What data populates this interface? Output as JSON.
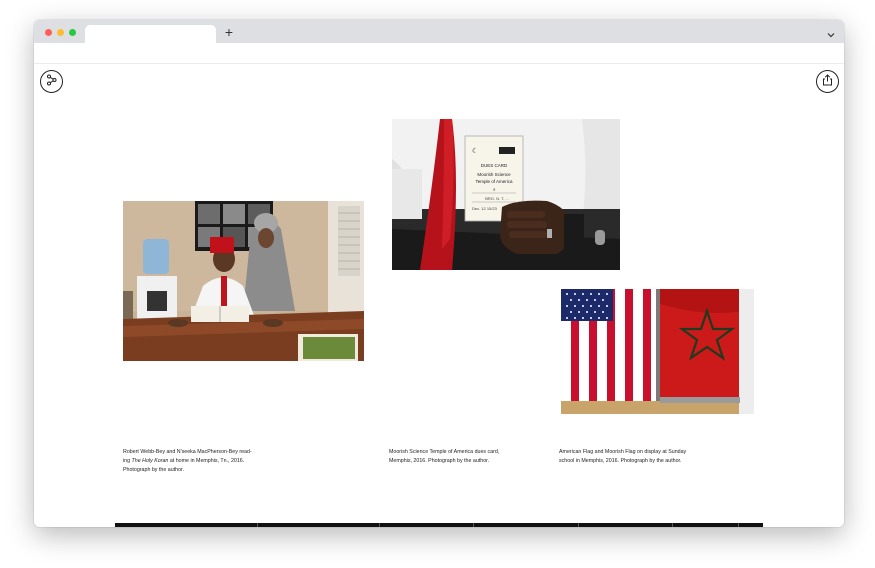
{
  "browser": {
    "new_tab_label": "+",
    "tab_title": ""
  },
  "icons": {
    "menu": "scatter-menu-icon",
    "share": "share-icon",
    "tab_menu": "chevron-down-icon"
  },
  "gallery": {
    "captions": [
      {
        "part1": "Robert Webb-Bey and N'seeka MacPherson-Bey read-",
        "part2a": "ing ",
        "italic": "The Holy Koran",
        "part2b": " at home in Memphis, Tn., 2016.",
        "part3": "Photograph by the author."
      },
      {
        "line1": "Moorish Science Temple of America dues card,",
        "line2": "Memphis, 2016. Photograph by the author."
      },
      {
        "line1": "American Flag and Moorish Flag on display at Sunday",
        "line2": "school in Memphis, 2016. Photograph by the author."
      }
    ],
    "dues_card": {
      "line1": "DUES CARD",
      "line2": "Moorish Science",
      "line3": "Temple of America",
      "line4": "4",
      "line5": "BRO. N. T. ...",
      "line6": "Dec. 12 15/23"
    }
  }
}
